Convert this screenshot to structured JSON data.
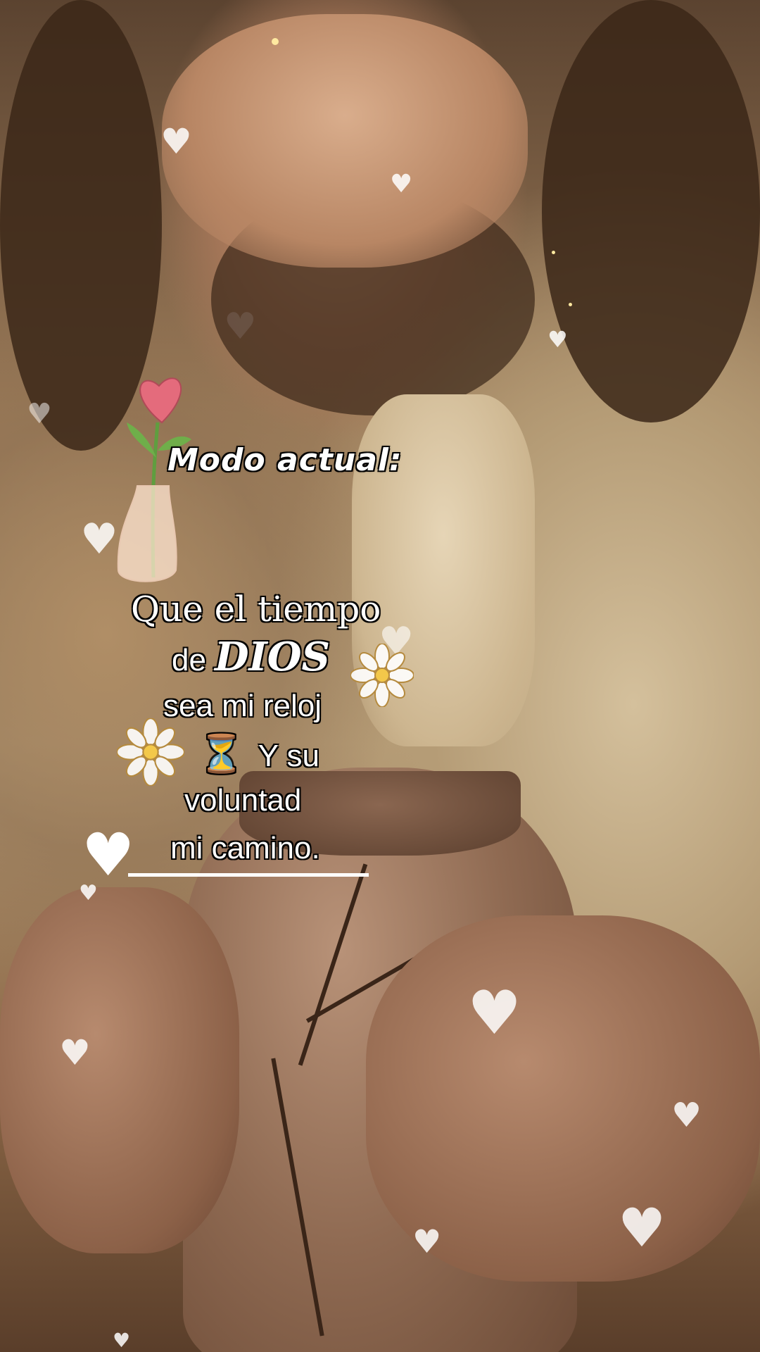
{
  "overlay": {
    "mode_label": "Modo actual:",
    "line1": "Que el tiempo",
    "line2_prefix": "de",
    "line2_emph": "DIOS",
    "line3": "sea mi reloj",
    "line4": "Y su",
    "line5": "voluntad",
    "line6": "mi camino."
  },
  "emojis": {
    "hourglass": "⏳",
    "flower": "✿",
    "heart": "♥"
  },
  "colors": {
    "text": "#ffffff",
    "rose": "#e46b7c",
    "stem": "#5f9e3f"
  }
}
